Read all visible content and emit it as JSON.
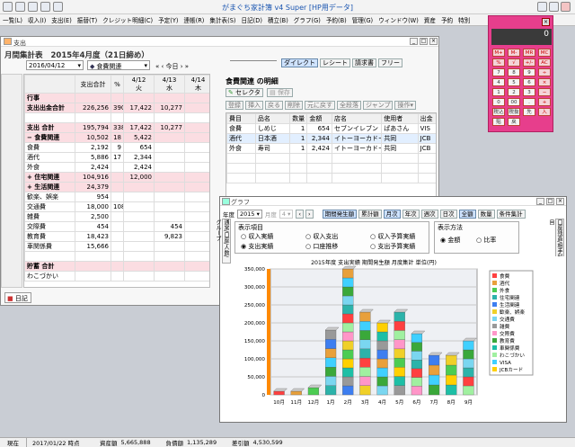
{
  "app": {
    "title": "がまぐち家計簿 v4 Super [HP用データ]"
  },
  "menu": [
    "一覧(L)",
    "収入(I)",
    "支出(E)",
    "振替(T)",
    "クレジット明細(C)",
    "予定(Y)",
    "連帳(R)",
    "集計表(S)",
    "日記(D)",
    "積立(B)",
    "グラフ(G)",
    "予約(B)",
    "管理(G)",
    "ウィンドウ(W)",
    "資産",
    "予約",
    "特別"
  ],
  "main": {
    "window_title": "支出",
    "heading": "月間集計表",
    "period": "2015年4月度（21日締め）",
    "date": "2016/04/12",
    "category": "食費関連",
    "nav": "« ‹ 今日 › »",
    "columns": [
      "",
      "支出合計",
      "%",
      "4/12\n火",
      "4/13\n水",
      "4/14\n木"
    ],
    "rows": [
      {
        "label": "行事",
        "vals": [
          "",
          "",
          "",
          "",
          ""
        ],
        "c": "pink"
      },
      {
        "label": "支出出金合計",
        "vals": [
          "226,256",
          "390",
          "17,422",
          "10,277",
          ""
        ],
        "c": "pink"
      },
      {
        "label": "",
        "vals": [
          "",
          "",
          "",
          "",
          ""
        ],
        "c": "lt"
      },
      {
        "label": "支出 合計",
        "vals": [
          "195,794",
          "338",
          "17,422",
          "10,277",
          ""
        ],
        "c": "pink"
      },
      {
        "label": "− 食費関連",
        "vals": [
          "10,502",
          "18",
          "5,422",
          "",
          ""
        ],
        "c": "pink"
      },
      {
        "label": "食費",
        "vals": [
          "2,192",
          "9",
          "654",
          "",
          ""
        ],
        "c": "lt"
      },
      {
        "label": "酒代",
        "vals": [
          "5,886",
          "17",
          "2,344",
          "",
          ""
        ],
        "c": "lt"
      },
      {
        "label": "外食",
        "vals": [
          "2,424",
          "",
          "2,424",
          "",
          ""
        ],
        "c": "lt"
      },
      {
        "label": "+ 住宅関連",
        "vals": [
          "104,916",
          "",
          "12,000",
          "",
          ""
        ],
        "c": "pink"
      },
      {
        "label": "+ 生活関連",
        "vals": [
          "24,379",
          "",
          "",
          "",
          ""
        ],
        "c": "pink"
      },
      {
        "label": "歓楽、娯楽",
        "vals": [
          "954",
          "",
          "",
          "",
          ""
        ],
        "c": "lt"
      },
      {
        "label": "交通費",
        "vals": [
          "18,000",
          "108",
          "",
          "",
          ""
        ],
        "c": "lt"
      },
      {
        "label": "雑費",
        "vals": [
          "2,500",
          "",
          "",
          "",
          ""
        ],
        "c": "lt"
      },
      {
        "label": "交際費",
        "vals": [
          "454",
          "",
          "",
          "454",
          ""
        ],
        "c": "lt"
      },
      {
        "label": "教育費",
        "vals": [
          "18,423",
          "",
          "",
          "9,823",
          ""
        ],
        "c": "lt"
      },
      {
        "label": "車関係費",
        "vals": [
          "15,666",
          "",
          "",
          "",
          ""
        ],
        "c": "lt"
      },
      {
        "label": "",
        "vals": [
          "",
          "",
          "",
          "",
          ""
        ],
        "c": "lt"
      },
      {
        "label": "貯蓄 合計",
        "vals": [
          "",
          "",
          "",
          "",
          ""
        ],
        "c": "pink"
      },
      {
        "label": "わこづかい",
        "vals": [
          "",
          "",
          "",
          "",
          ""
        ],
        "c": "lt"
      }
    ],
    "diary_tab": "日記",
    "detail_tabs": [
      "ダイレクト",
      "レシート",
      "請求書",
      "フリー"
    ],
    "detail_title": "食費関連 の明細",
    "select_label": "セレクタ",
    "save_label": "保存",
    "toolbar": [
      "登録",
      "挿入",
      "戻る",
      "削除",
      "元に戻す",
      "全段落",
      "ジャンプ",
      "操作▾"
    ],
    "detail_cols": [
      "費目",
      "品名",
      "数量",
      "金額",
      "店名",
      "使用者",
      "出金"
    ],
    "detail_rows": [
      [
        "食費",
        "しめじ",
        "1",
        "654",
        "セブンイレブン",
        "ぱあさん",
        "VIS"
      ],
      [
        "酒代",
        "日本酒",
        "1",
        "2,344",
        "イトーヨーカドー",
        "共同",
        "JCB"
      ],
      [
        "外食",
        "寿司",
        "1",
        "2,424",
        "イトーヨーカドー",
        "共同",
        "JCB"
      ]
    ]
  },
  "calc": {
    "display": "0",
    "mem": "0",
    "keys": [
      "M+",
      "M-",
      "MR",
      "MC",
      "%",
      "√",
      "+/-",
      "AC",
      "7",
      "8",
      "9",
      "÷",
      "4",
      "5",
      "6",
      "×",
      "1",
      "2",
      "3",
      "−",
      "0",
      "00",
      ".",
      "+",
      "税込",
      "税抜",
      "先",
      "入",
      "貼",
      "戻"
    ]
  },
  "graph": {
    "window_title": "グラフ",
    "year_label": "年度",
    "year": "2015",
    "month_label": "月度",
    "month": "4",
    "tabs": [
      "期間発生額",
      "累計額",
      "月次",
      "年次",
      "週次",
      "日次",
      "全額",
      "数量",
      "条件集計"
    ],
    "side_left": "通常/口座/人数/グループ",
    "side_right": "口座残高/相手科目",
    "options_title": "表示項目",
    "options": [
      "収入実績",
      "収入支出",
      "収入予算実績",
      "支出実績",
      "口座推移",
      "支出予算実績"
    ],
    "method_title": "表示方法",
    "methods": [
      "金額",
      "比率"
    ],
    "chart_title": "2015年度 支出実績 期間発生額 月度集計 単位(円)"
  },
  "chart_data": {
    "type": "bar",
    "title": "2015年度 支出実績 期間発生額 月度集計 単位(円)",
    "categories": [
      "10月",
      "11月",
      "12月",
      "1月",
      "2月",
      "3月",
      "4月",
      "5月",
      "6月",
      "7月",
      "8月",
      "9月"
    ],
    "ylim": [
      0,
      350000
    ],
    "yticks": [
      "0",
      "50,000",
      "100,000",
      "150,000",
      "200,000",
      "250,000",
      "300,000",
      "350,000"
    ],
    "totals": [
      10000,
      10000,
      20000,
      180000,
      350000,
      230000,
      200000,
      230000,
      170000,
      110000,
      110000,
      150000
    ],
    "legend": [
      "食費",
      "酒代",
      "外食",
      "住宅関連",
      "生活関連",
      "歓楽、娯楽",
      "交通費",
      "雑費",
      "交際費",
      "教育費",
      "車関係費",
      "わこづかい",
      "VISA",
      "JCBカード"
    ],
    "colors": [
      "#ff4040",
      "#e8a03b",
      "#4ccc52",
      "#2cb3aa",
      "#3d7ef0",
      "#f0d028",
      "#7ad6f0",
      "#999999",
      "#ff96c8",
      "#3aa83a",
      "#1dbfa6",
      "#a0f0a0",
      "#40d0ff",
      "#ffd000"
    ]
  },
  "status": {
    "mode": "現在",
    "date": "2017/01/22 時点",
    "assets_label": "資産額",
    "assets": "5,665,888",
    "debt_label": "負債額",
    "debt": "1,135,289",
    "net_label": "差引額",
    "net": "4,530,599"
  }
}
